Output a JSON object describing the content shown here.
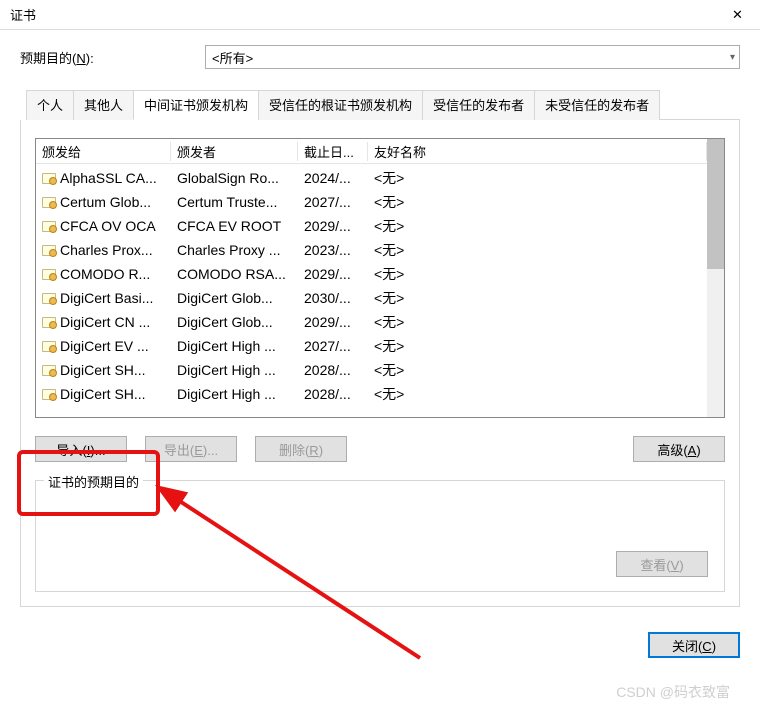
{
  "window": {
    "title": "证书"
  },
  "purpose": {
    "label_pre": "预期目的(",
    "label_key": "N",
    "label_post": "):",
    "selected": "<所有>"
  },
  "tabs": [
    {
      "label": "个人"
    },
    {
      "label": "其他人"
    },
    {
      "label": "中间证书颁发机构"
    },
    {
      "label": "受信任的根证书颁发机构"
    },
    {
      "label": "受信任的发布者"
    },
    {
      "label": "未受信任的发布者"
    }
  ],
  "active_tab": 2,
  "columns": {
    "c0": "颁发给",
    "c1": "颁发者",
    "c2": "截止日...",
    "c3": "友好名称"
  },
  "rows": [
    {
      "issued_to": "AlphaSSL CA...",
      "issued_by": "GlobalSign Ro...",
      "exp": "2024/...",
      "name": "<无>"
    },
    {
      "issued_to": "Certum Glob...",
      "issued_by": "Certum Truste...",
      "exp": "2027/...",
      "name": "<无>"
    },
    {
      "issued_to": "CFCA OV OCA",
      "issued_by": "CFCA EV ROOT",
      "exp": "2029/...",
      "name": "<无>"
    },
    {
      "issued_to": "Charles Prox...",
      "issued_by": "Charles Proxy ...",
      "exp": "2023/...",
      "name": "<无>"
    },
    {
      "issued_to": "COMODO R...",
      "issued_by": "COMODO RSA...",
      "exp": "2029/...",
      "name": "<无>"
    },
    {
      "issued_to": "DigiCert Basi...",
      "issued_by": "DigiCert Glob...",
      "exp": "2030/...",
      "name": "<无>"
    },
    {
      "issued_to": "DigiCert CN ...",
      "issued_by": "DigiCert Glob...",
      "exp": "2029/...",
      "name": "<无>"
    },
    {
      "issued_to": "DigiCert EV ...",
      "issued_by": "DigiCert High ...",
      "exp": "2027/...",
      "name": "<无>"
    },
    {
      "issued_to": "DigiCert SH...",
      "issued_by": "DigiCert High ...",
      "exp": "2028/...",
      "name": "<无>"
    },
    {
      "issued_to": "DigiCert SH...",
      "issued_by": "DigiCert High ...",
      "exp": "2028/...",
      "name": "<无>"
    }
  ],
  "buttons": {
    "import_pre": "导入(",
    "import_key": "I",
    "import_post": ")...",
    "export_pre": "导出(",
    "export_key": "E",
    "export_post": ")...",
    "remove_pre": "删除(",
    "remove_key": "R",
    "remove_post": ")",
    "advanced_pre": "高级(",
    "advanced_key": "A",
    "advanced_post": ")",
    "view_pre": "查看(",
    "view_key": "V",
    "view_post": ")",
    "close_pre": "关闭(",
    "close_key": "C",
    "close_post": ")"
  },
  "fieldset_legend": "证书的预期目的",
  "watermark": "CSDN @码衣致富"
}
